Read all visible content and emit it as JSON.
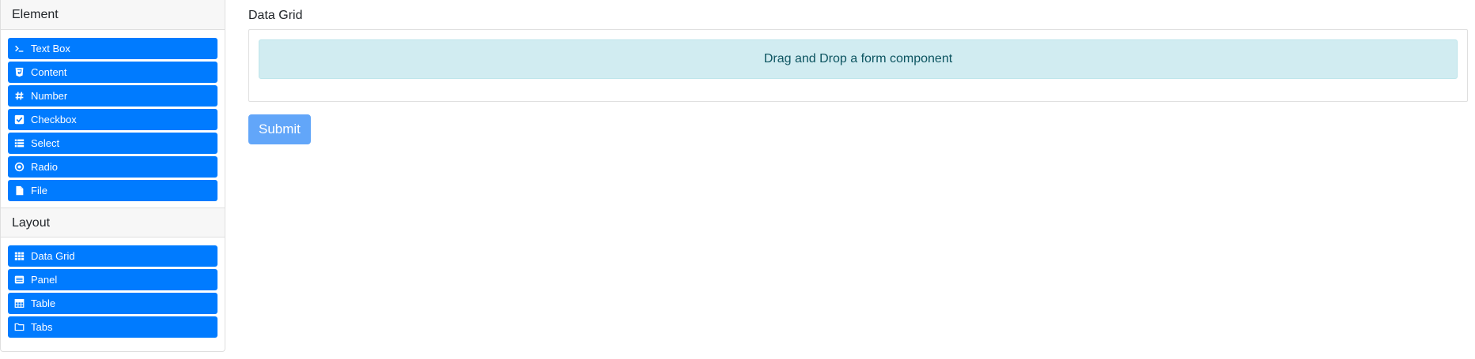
{
  "sidebar": {
    "element_header": "Element",
    "layout_header": "Layout",
    "elements": [
      {
        "label": "Text Box",
        "icon": "terminal-icon"
      },
      {
        "label": "Content",
        "icon": "html5-icon"
      },
      {
        "label": "Number",
        "icon": "hashtag-icon"
      },
      {
        "label": "Checkbox",
        "icon": "check-square-icon"
      },
      {
        "label": "Select",
        "icon": "list-icon"
      },
      {
        "label": "Radio",
        "icon": "dot-circle-icon"
      },
      {
        "label": "File",
        "icon": "file-icon"
      }
    ],
    "layouts": [
      {
        "label": "Data Grid",
        "icon": "th-icon"
      },
      {
        "label": "Panel",
        "icon": "list-alt-icon"
      },
      {
        "label": "Table",
        "icon": "table-icon"
      },
      {
        "label": "Tabs",
        "icon": "folder-open-icon"
      }
    ]
  },
  "main": {
    "grid_label": "Data Grid",
    "drop_text": "Drag and Drop a form component",
    "submit_label": "Submit"
  },
  "colors": {
    "primary": "#007bff",
    "submit_disabled": "#62a6f9",
    "drop_bg": "#d1ecf1",
    "drop_text": "#0c5460"
  }
}
